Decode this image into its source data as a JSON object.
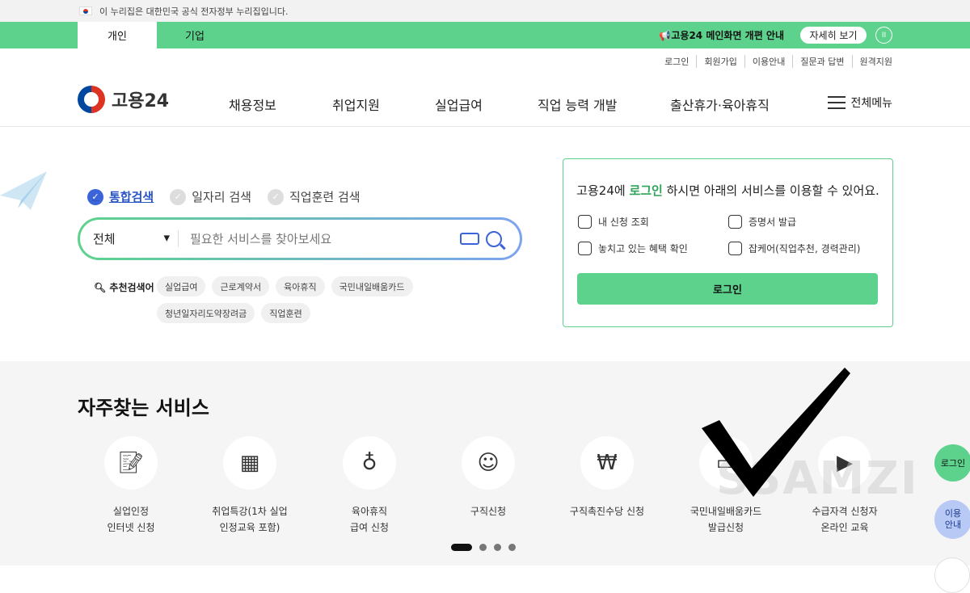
{
  "gov_banner": {
    "text": "이 누리집은 대한민국 공식 전자정부 누리집입니다."
  },
  "user_tabs": [
    {
      "label": "개인",
      "active": true
    },
    {
      "label": "기업",
      "active": false
    }
  ],
  "notice": {
    "text": "📢고용24 메인화면 개편 안내",
    "button": "자세히 보기",
    "pause": "II"
  },
  "util_links": [
    "로그인",
    "회원가입",
    "이용안내",
    "질문과 답변",
    "원격지원"
  ],
  "logo": {
    "text": "고용24"
  },
  "nav": [
    "채용정보",
    "취업지원",
    "실업급여",
    "직업 능력 개발",
    "출산휴가·육아휴직"
  ],
  "menu_all": "전체메뉴",
  "search": {
    "tabs": [
      {
        "label": "통합검색",
        "active": true
      },
      {
        "label": "일자리 검색",
        "active": false
      },
      {
        "label": "직업훈련 검색",
        "active": false
      }
    ],
    "select_value": "전체",
    "placeholder": "필요한 서비스를 찾아보세요",
    "rec_label": "추천검색어",
    "chips": [
      "실업급여",
      "근로계약서",
      "육아휴직",
      "국민내일배움카드",
      "청년일자리도약장려금",
      "직업훈련"
    ]
  },
  "login_panel": {
    "title_pre": "고용24에 ",
    "title_hl": "로그인",
    "title_post": " 하시면 아래의 서비스를 이용할 수 있어요.",
    "items": [
      "내 신청 조회",
      "증명서 발급",
      "놓치고 있는 혜택 확인",
      "잡케어(직업추천, 경력관리)"
    ],
    "button": "로그인"
  },
  "frequent": {
    "title": "자주찾는 서비스",
    "services": [
      {
        "label": "실업인정\n인터넷 신청",
        "icon": "document-pen-icon"
      },
      {
        "label": "취업특강(1차 실업\n인정교육 포함)",
        "icon": "presentation-board-icon"
      },
      {
        "label": "육아휴직\n급여 신청",
        "icon": "baby-bottle-icon"
      },
      {
        "label": "구직신청",
        "icon": "person-pen-icon"
      },
      {
        "label": "구직촉진수당 신청",
        "icon": "money-bag-icon"
      },
      {
        "label": "국민내일배움카드\n발급신청",
        "icon": "card-icon"
      },
      {
        "label": "수급자격 신청자\n온라인 교육",
        "icon": "monitor-play-icon"
      }
    ]
  },
  "side": {
    "login": "로그인",
    "guide": "이용\n안내"
  },
  "watermark": "SSAMZI"
}
